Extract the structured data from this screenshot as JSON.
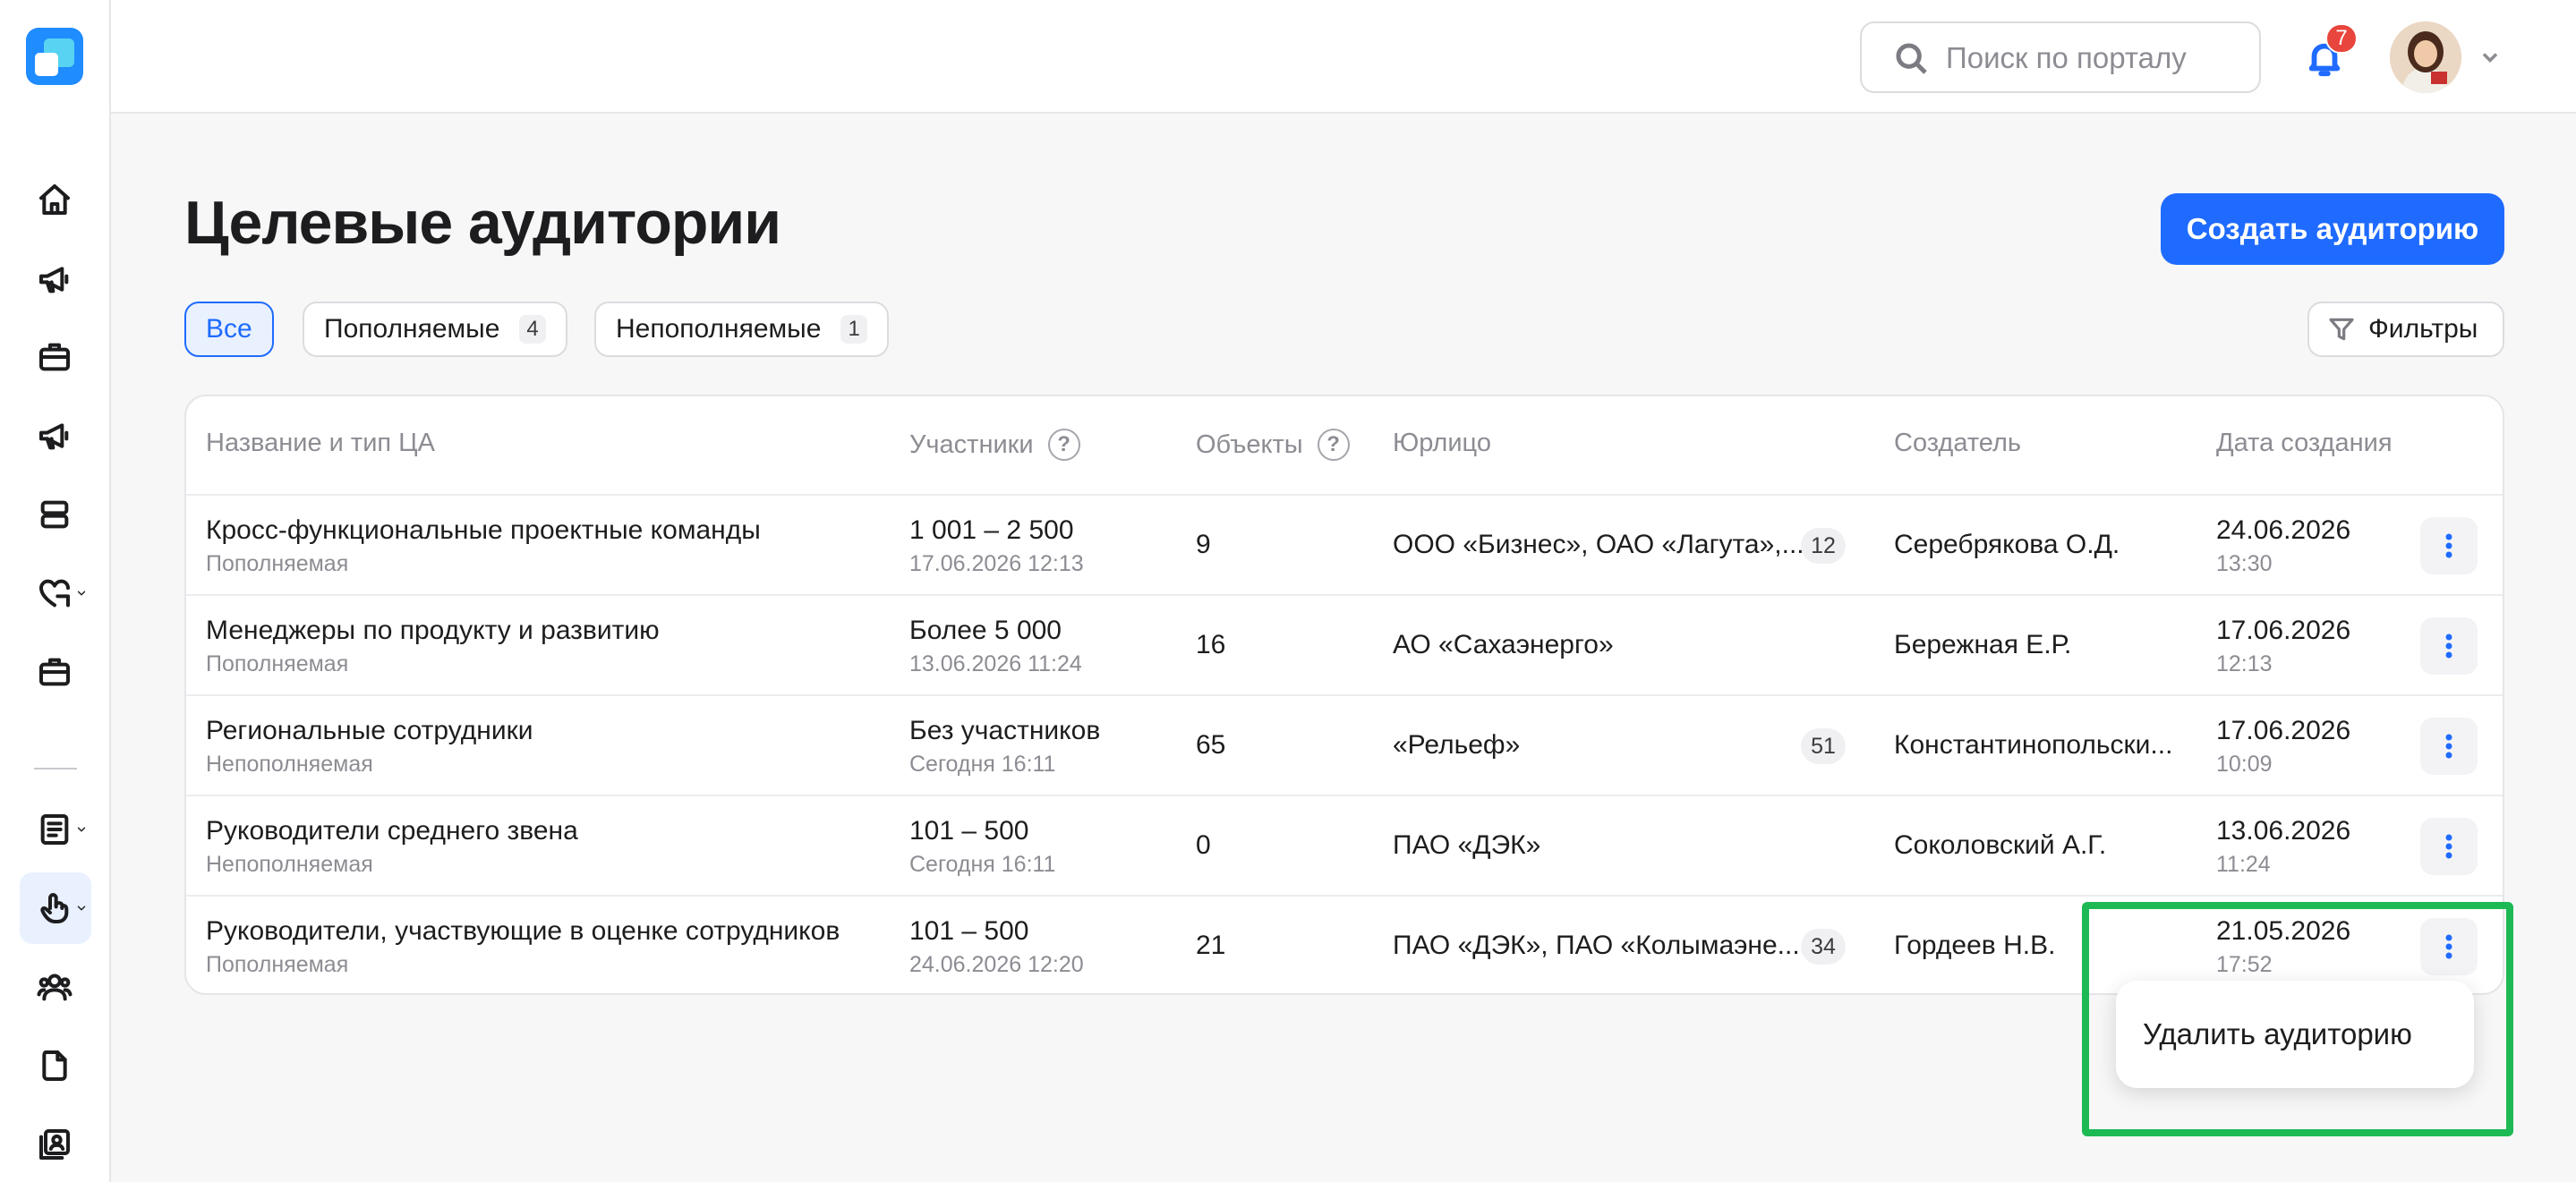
{
  "header": {
    "search_placeholder": "Поиск по порталу",
    "notifications_count": "7"
  },
  "page": {
    "title": "Целевые аудитории",
    "create_button": "Создать аудиторию",
    "filters_button": "Фильтры"
  },
  "tabs": [
    {
      "label": "Все",
      "count": "",
      "active": true
    },
    {
      "label": "Пополняемые",
      "count": "4",
      "active": false
    },
    {
      "label": "Непополняемые",
      "count": "1",
      "active": false
    }
  ],
  "table": {
    "columns": {
      "name": "Название и тип ЦА",
      "participants": "Участники",
      "objects": "Объекты",
      "entity": "Юрлицо",
      "creator": "Создатель",
      "created": "Дата создания"
    },
    "rows": [
      {
        "name": "Кросс-функциональные проектные команды",
        "type": "Пополняемая",
        "participants": "1 001 – 2 500",
        "participants_date": "17.06.2026 12:13",
        "objects": "9",
        "entity": "ООО «Бизнес», ОАО «Лагута»,...",
        "entity_count": "12",
        "creator": "Серебрякова О.Д.",
        "date": "24.06.2026",
        "time": "13:30"
      },
      {
        "name": "Менеджеры по продукту и развитию",
        "type": "Пополняемая",
        "participants": "Более 5 000",
        "participants_date": "13.06.2026 11:24",
        "objects": "16",
        "entity": "АО «Сахаэнерго»",
        "entity_count": "",
        "creator": "Бережная Е.Р.",
        "date": "17.06.2026",
        "time": "12:13"
      },
      {
        "name": "Региональные сотрудники",
        "type": "Непополняемая",
        "participants": "Без участников",
        "participants_date": "Сегодня 16:11",
        "objects": "65",
        "entity": "«Рельеф»",
        "entity_count": "51",
        "creator": "Константинопольски...",
        "date": "17.06.2026",
        "time": "10:09"
      },
      {
        "name": "Руководители среднего звена",
        "type": "Непополняемая",
        "participants": "101 – 500",
        "participants_date": "Сегодня 16:11",
        "objects": "0",
        "entity": "ПАО «ДЭК»",
        "entity_count": "",
        "creator": "Соколовский А.Г.",
        "date": "13.06.2026",
        "time": "11:24"
      },
      {
        "name": "Руководители, участвующие в оценке сотрудников",
        "type": "Пополняемая",
        "participants": "101 – 500",
        "participants_date": "24.06.2026 12:20",
        "objects": "21",
        "entity": "ПАО «ДЭК», ПАО «Колымаэне...",
        "entity_count": "34",
        "creator": "Гордеев Н.В.",
        "date": "21.05.2026",
        "time": "17:52"
      }
    ]
  },
  "context_menu": {
    "delete_label": "Удалить аудиторию"
  },
  "colors": {
    "accent": "#1f6bff",
    "highlight": "#1db954",
    "badge": "#e8453c"
  }
}
